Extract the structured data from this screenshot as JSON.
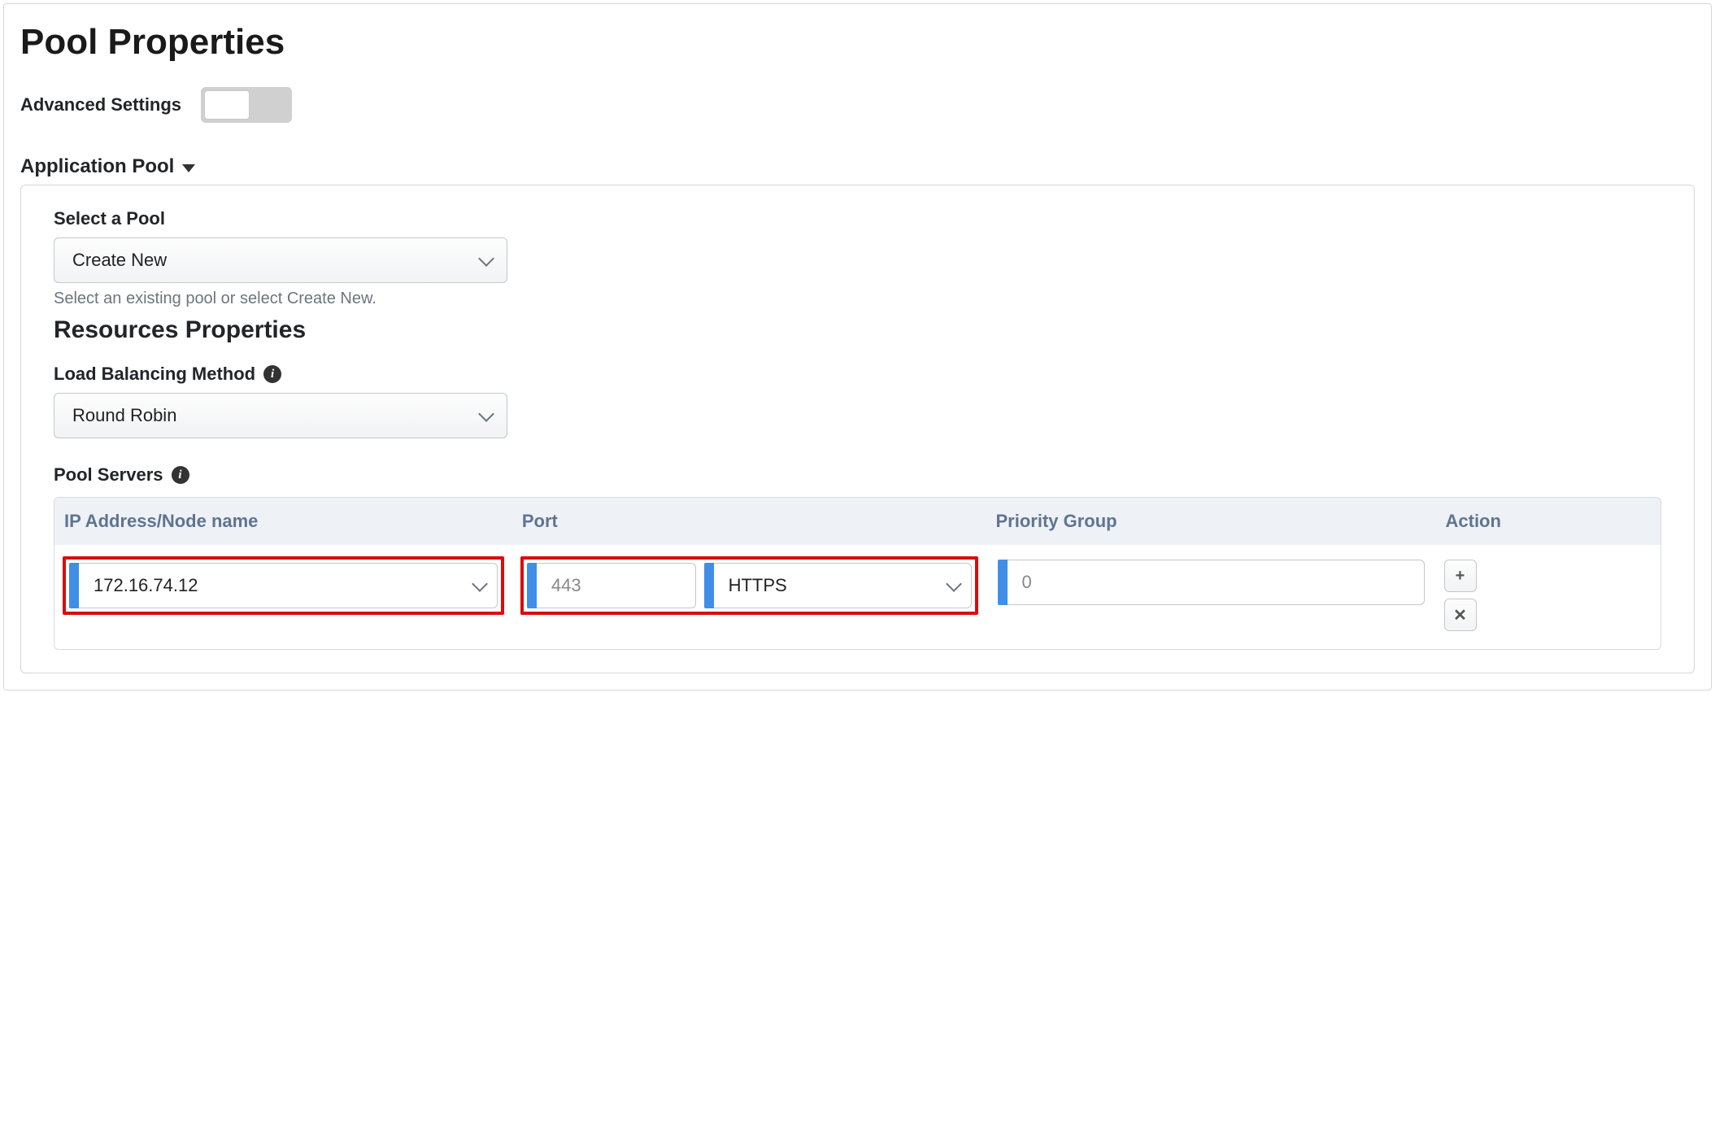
{
  "page_title": "Pool Properties",
  "advanced_settings": {
    "label": "Advanced Settings",
    "on": false
  },
  "section": {
    "title": "Application Pool"
  },
  "select_pool": {
    "label": "Select a Pool",
    "value": "Create New",
    "help": "Select an existing pool or select Create New."
  },
  "resources_title": "Resources Properties",
  "lb_method": {
    "label": "Load Balancing Method",
    "value": "Round Robin"
  },
  "pool_servers": {
    "label": "Pool Servers",
    "columns": {
      "ip": "IP Address/Node name",
      "port": "Port",
      "pg": "Priority Group",
      "action": "Action"
    },
    "rows": [
      {
        "ip": "172.16.74.12",
        "port": "443",
        "protocol": "HTTPS",
        "priority_group": "0"
      }
    ]
  },
  "icons": {
    "info": "i",
    "plus": "+",
    "close": "✕"
  }
}
